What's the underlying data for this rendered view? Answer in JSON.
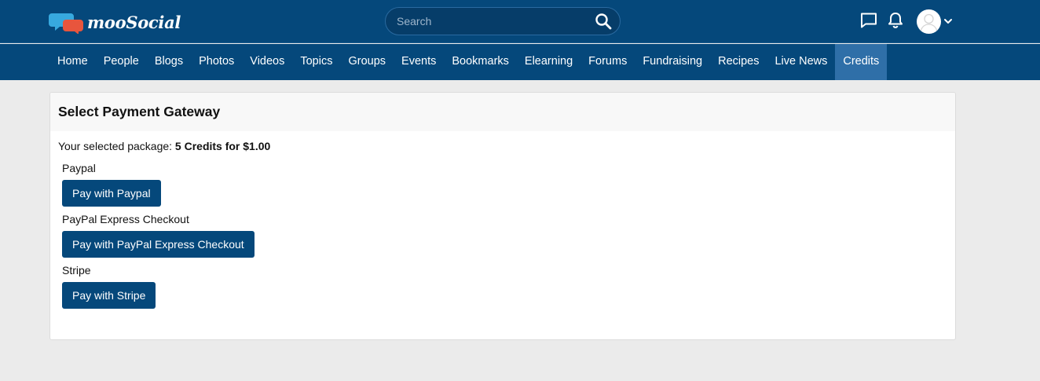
{
  "header": {
    "logo_text": "mooSocial",
    "search_placeholder": "Search",
    "search_value": ""
  },
  "nav": {
    "items": [
      {
        "label": "Home"
      },
      {
        "label": "People"
      },
      {
        "label": "Blogs"
      },
      {
        "label": "Photos"
      },
      {
        "label": "Videos"
      },
      {
        "label": "Topics"
      },
      {
        "label": "Groups"
      },
      {
        "label": "Events"
      },
      {
        "label": "Bookmarks"
      },
      {
        "label": "Elearning"
      },
      {
        "label": "Forums"
      },
      {
        "label": "Fundraising"
      },
      {
        "label": "Recipes"
      },
      {
        "label": "Live News"
      },
      {
        "label": "Credits",
        "active": true
      }
    ]
  },
  "panel": {
    "title": "Select Payment Gateway",
    "selected_prefix": "Your selected package:",
    "selected_package": "5 Credits for $1.00",
    "gateways": [
      {
        "name": "Paypal",
        "button": "Pay with Paypal"
      },
      {
        "name": "PayPal Express Checkout",
        "button": "Pay with PayPal Express Checkout"
      },
      {
        "name": "Stripe",
        "button": "Pay with Stripe"
      }
    ]
  },
  "colors": {
    "brand": "#05487b",
    "nav_active": "#2f6fa8",
    "page_bg": "#ebebeb"
  }
}
